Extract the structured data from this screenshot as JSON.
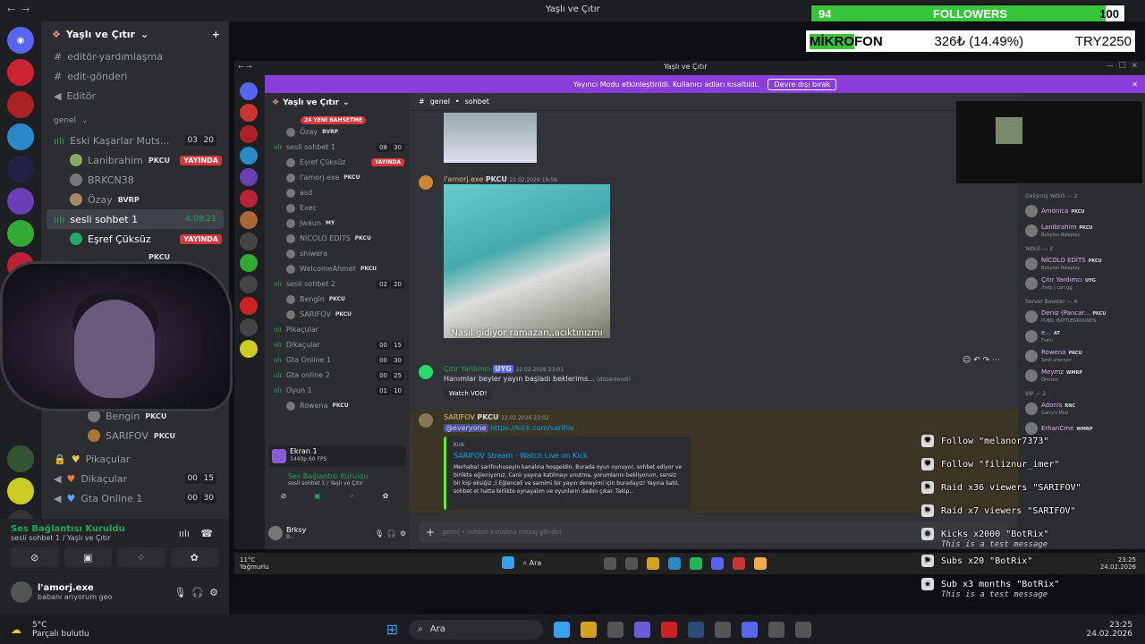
{
  "outer": {
    "window_title": "Yaşlı ve Çıtır",
    "server_name": "Yaşlı ve Çıtır",
    "channels_top": [
      "editör-yardımlaşma",
      "edit-gönderi",
      "Editör"
    ],
    "category": "genel",
    "voice1": {
      "name": "Eski Kaşarlar Muts...",
      "count_a": "03",
      "count_b": "20"
    },
    "voice1_users": [
      {
        "name": "Lanibrahim",
        "tag": "PKCU",
        "live": "YAYINDA"
      },
      {
        "name": "BRKCN38"
      },
      {
        "name": "Özay",
        "tag": "BVRP"
      }
    ],
    "active_voice": {
      "name": "sesli sohbet 1",
      "time": "4:08:21"
    },
    "active_users": [
      {
        "name": "Eşref Çüksüz",
        "live": "YAYINDA"
      },
      {
        "name": "",
        "tag": "PKCU"
      }
    ],
    "lower_users": [
      {
        "name": "Bengin",
        "tag": "PKCU"
      },
      {
        "name": "SARIFOV",
        "tag": "PKCU"
      }
    ],
    "lower_channels": [
      {
        "name": "Pikaçular"
      },
      {
        "name": "Dikaçular",
        "a": "00",
        "b": "15"
      },
      {
        "name": "Gta Online 1",
        "a": "00",
        "b": "30"
      }
    ],
    "voice_status": {
      "title": "Ses Bağlantısı Kuruldu",
      "sub": "sesli sohbet 1 / Yaşlı ve Çıtır"
    },
    "user": {
      "name": "l'amorj.exe",
      "status": "babanı arıyorum geo"
    }
  },
  "inner": {
    "window_title": "Yaşlı ve Çıtır",
    "banner_text": "Yayıncı Modu etkinleştirildi. Kullanıcı adları kısaltıldı.",
    "banner_button": "Devre dışı bırak",
    "server_name": "Yaşlı ve Çıtır",
    "new_badge": "24 YENİ BAHSETME",
    "chat_header": {
      "channel": "genel",
      "sub": "sohbet"
    },
    "channels": [
      {
        "kind": "user",
        "name": "Özay",
        "tag": "BVRP"
      },
      {
        "kind": "voice",
        "name": "sesli sohbet 1",
        "a": "08",
        "b": "30"
      },
      {
        "kind": "user",
        "name": "Eşref Çüksüz",
        "live": "YAYINDA"
      },
      {
        "kind": "user",
        "name": "l'amorj.exe",
        "tag": "PKCU"
      },
      {
        "kind": "user",
        "name": "asd"
      },
      {
        "kind": "user",
        "name": "Exec"
      },
      {
        "kind": "user",
        "name": "Jwaun",
        "tag": "MY"
      },
      {
        "kind": "user",
        "name": "NİCOLO EDİTS",
        "tag": "PKCU"
      },
      {
        "kind": "user",
        "name": "shiwera"
      },
      {
        "kind": "user",
        "name": "WelcomeAhmet",
        "tag": "PKCU"
      },
      {
        "kind": "voice",
        "name": "sesli sohbet 2",
        "a": "02",
        "b": "20"
      },
      {
        "kind": "user",
        "name": "Bengin",
        "tag": "PKCU"
      },
      {
        "kind": "user",
        "name": "SARIFOV",
        "tag": "PKCU"
      },
      {
        "kind": "voice",
        "name": "Pikaçular"
      },
      {
        "kind": "voice",
        "name": "Dikaçular",
        "a": "00",
        "b": "15"
      },
      {
        "kind": "voice",
        "name": "Gta Online 1",
        "a": "00",
        "b": "30"
      },
      {
        "kind": "voice",
        "name": "Gta online 2",
        "a": "00",
        "b": "25"
      },
      {
        "kind": "voice",
        "name": "Oyun 1",
        "a": "01",
        "b": "10"
      },
      {
        "kind": "user",
        "name": "Rowena",
        "tag": "PKCU"
      }
    ],
    "screen_panel": {
      "title": "Ekran 1",
      "sub": "1440p 60 FPS"
    },
    "voice_status": {
      "title": "Ses Bağlantısı Kuruldu",
      "sub": "sesli sohbet 1 / Yaşlı ve Çıtır"
    },
    "user": {
      "name": "Brksy",
      "status": "B..."
    },
    "messages": [
      {
        "author": "l'amorj.exe",
        "tag": "PKCU",
        "time": "22.02.2026 19:56",
        "caption": "Nasıl gidiyor ramazan,,acıktınızmı"
      },
      {
        "author": "Çıtır Yardımcı",
        "tag": "UYG",
        "time": "22.02.2026 23:01",
        "text": "Hanımlar beyler yayın başladı beklerims...",
        "edited": "(düzenlendi)",
        "button": "Watch VOD!"
      },
      {
        "author": "SARIFOV",
        "tag": "PKCU",
        "time": "22.02.2026 23:02",
        "mention": "@everyone",
        "link": "https://kick.com/sarifov",
        "embed": {
          "provider": "Kick",
          "title": "SARIFOV Stream - Watch Live on Kick",
          "desc": "Merhaba! sarifovhuseyin kanalına hoşgeldin. Burada oyun oynuyor, sohbet ediyor ve birlikte eğleniyoruz. Canlı yayına katılmayı unutma, yorumlarını bekliyorum, sensiz bir kişi eksiğiz ;) Eğlenceli ve samimi bir yayın deneyimi için buradayız! Yayına katıl, sohbet et hatta birlikte oynayalım ve oyunların dadını çıkar. Takip..."
        }
      }
    ],
    "input_placeholder": "genel • sohbet kanalına mesaj gönder",
    "members": [
      {
        "group": "Gelişmiş Yetkili — 2"
      },
      {
        "name": "Amönica",
        "tag": "PKCU"
      },
      {
        "name": "Lanibrahim",
        "tag": "PKCU",
        "sub": "Babylon Roleplay"
      },
      {
        "group": "Yetkili — 2"
      },
      {
        "name": "NİCOLO EDİTS",
        "tag": "PKCU",
        "sub": "Babylon Roleplay"
      },
      {
        "name": "Çıtır Yardımcı",
        "tag": "UYG",
        "sub": "/help | carl.gg"
      },
      {
        "group": "Server Booster — 4"
      },
      {
        "name": "Deniz (Pancar...",
        "tag": "PKCU",
        "sub": "PUBG: BATTLEGROUNDS"
      },
      {
        "name": "e...",
        "tag": "AT",
        "sub": "Fushi"
      },
      {
        "name": "Rowena",
        "tag": "PKCU",
        "sub": "Sesli aranıyor"
      },
      {
        "name": "Meymz",
        "tag": "WMRP",
        "sub": "Ömrüm"
      },
      {
        "group": "VIP — 2"
      },
      {
        "name": "Adonis",
        "tag": "RNC",
        "sub": "Garry's Mod"
      },
      {
        "name": "ErhanCme",
        "tag": "WMRP"
      }
    ]
  },
  "alerts": [
    {
      "icon": "heart",
      "text": "Follow \"melanor7373\""
    },
    {
      "icon": "heart",
      "text": "Follow \"filiznur_imer\""
    },
    {
      "icon": "raid",
      "text": "Raid x36 viewers \"SARIFOV\""
    },
    {
      "icon": "raid",
      "text": "Raid x7 viewers \"SARIFOV\""
    },
    {
      "icon": "kick",
      "text": "Kicks x2000 \"BotRix\"",
      "sub": "This is a test message"
    },
    {
      "icon": "subs",
      "text": "Subs x20 \"BotRix\""
    },
    {
      "icon": "star",
      "text": "Sub x3 months \"BotRix\"",
      "sub": "This is a test message"
    }
  ],
  "followers": {
    "current": "94",
    "label": "FOLLOWERS",
    "goal": "100",
    "progress": 0.94
  },
  "mikrofon": {
    "label_a": "MİKRO",
    "label_b": "FON",
    "amount": "326₺ (14.49%)",
    "target": "TRY2250"
  },
  "taskbar": {
    "weather_temp": "5°C",
    "weather_desc": "Parçalı bulutlu",
    "search": "Ara",
    "time": "23:25",
    "date": "24.02.2026"
  },
  "inner_taskbar": {
    "weather_temp": "11°C",
    "weather_desc": "Yağmurlu",
    "search": "Ara",
    "time": "23:25",
    "date": "24.02.2026"
  },
  "colors": {
    "accent": "#5865f2",
    "live": "#da373c",
    "banner": "#8a3ddb",
    "follow_fill": "#36c43a"
  }
}
